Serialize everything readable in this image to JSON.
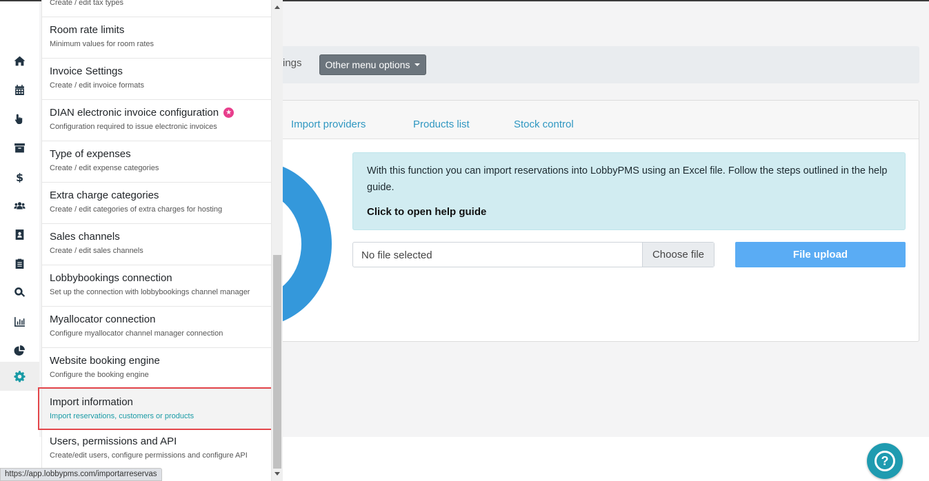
{
  "toolbar": {
    "partial_label": "ings",
    "menu_button": "Other menu options"
  },
  "tabs": [
    "Import providers",
    "Products list",
    "Stock control"
  ],
  "info": {
    "text": "With this function you can import reservations into LobbyPMS using an Excel file. Follow the steps outlined in the help guide.",
    "link": "Click to open help guide"
  },
  "file": {
    "no_file": "No file selected",
    "choose": "Choose file",
    "upload": "File upload"
  },
  "dropdown": {
    "cut_top": "Create / edit tax types",
    "items": [
      {
        "title": "Room rate limits",
        "subtitle": "Minimum values for room rates"
      },
      {
        "title": "Invoice Settings",
        "subtitle": "Create / edit invoice formats"
      },
      {
        "title": "DIAN electronic invoice configuration",
        "subtitle": "Configuration required to issue electronic invoices"
      },
      {
        "title": "Type of expenses",
        "subtitle": "Create / edit expense categories"
      },
      {
        "title": "Extra charge categories",
        "subtitle": "Create / edit categories of extra charges for hosting"
      },
      {
        "title": "Sales channels",
        "subtitle": "Create / edit sales channels"
      },
      {
        "title": "Lobbybookings connection",
        "subtitle": "Set up the connection with lobbybookings channel manager"
      },
      {
        "title": "Myallocator connection",
        "subtitle": "Configure myallocator channel manager connection"
      },
      {
        "title": "Website booking engine",
        "subtitle": "Configure the booking engine"
      },
      {
        "title": "Import information",
        "subtitle": "Import reservations, customers or products"
      },
      {
        "title": "Users, permissions and API",
        "subtitle": "Create/edit users, configure permissions and configure API"
      }
    ]
  },
  "status_url": "https://app.lobbypms.com/importarreservas",
  "sidebar_icons": [
    "home-icon",
    "calendar-icon",
    "hand-pointer-icon",
    "archive-icon",
    "dollar-icon",
    "users-icon",
    "address-book-icon",
    "clipboard-icon",
    "search-icon",
    "bar-chart-icon",
    "pie-chart-icon",
    "gear-icon"
  ],
  "colors": {
    "accent": "#1a9ba6",
    "highlight_border": "#e3464b",
    "upload_button": "#5aacf4",
    "cloud": "#3498db"
  }
}
